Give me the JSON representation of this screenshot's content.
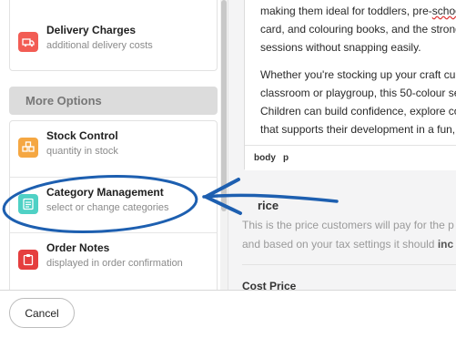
{
  "sidebar": {
    "items_top": [
      {
        "title": "Delivery Charges",
        "subtitle": "additional delivery costs",
        "icon": "truck-icon",
        "color": "#f25c54"
      }
    ],
    "more_options_label": "More Options",
    "items": [
      {
        "title": "Stock Control",
        "subtitle": "quantity in stock",
        "icon": "boxes-icon",
        "color": "#f5a742"
      },
      {
        "title": "Category Management",
        "subtitle": "select or change categories",
        "icon": "list-icon",
        "color": "#4fd1c5"
      },
      {
        "title": "Order Notes",
        "subtitle": "displayed in order confirmation",
        "icon": "clipboard-icon",
        "color": "#e53e3e"
      }
    ]
  },
  "editor": {
    "line1_a": "making them ideal for toddlers, pre-",
    "line1_b": "schoo",
    "line2": "card, and colouring books, and the strong",
    "line3": "sessions without snapping easily.",
    "line4": "Whether you're stocking up your craft cup",
    "line5": "classroom or playgroup, this 50-colour se",
    "line6": "Children can build confidence, explore co",
    "line7": "that supports their development in a fun, h",
    "status_path": [
      "body",
      "p"
    ]
  },
  "price": {
    "title": "rice",
    "desc_line1": "This is the price customers will pay for the p",
    "desc_line2a": "and based on your tax settings it should ",
    "desc_line2b": "inc"
  },
  "cost_price_title": "Cost Price",
  "footer": {
    "cancel_label": "Cancel"
  },
  "annotation": {
    "color": "#1d5fb0"
  }
}
